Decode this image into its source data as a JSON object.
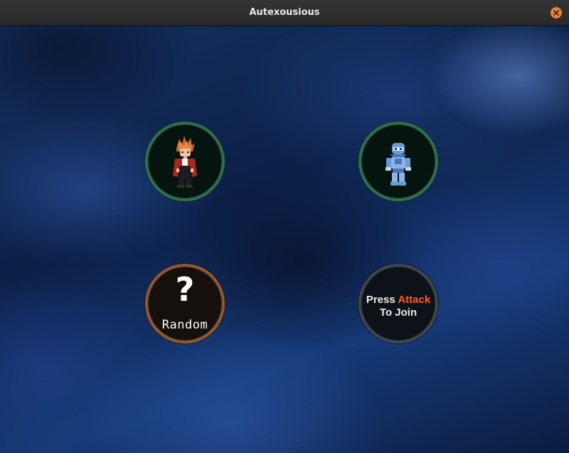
{
  "window": {
    "title": "Autexousious",
    "close_icon": "close-icon",
    "close_color": "#e9813a"
  },
  "slots": [
    {
      "state": "character-selected",
      "character_icon": "red-haired-fighter-sprite",
      "ring_color": "#2f6e52"
    },
    {
      "state": "character-selected",
      "character_icon": "blue-armored-robot-sprite",
      "ring_color": "#2f6e52"
    },
    {
      "state": "random",
      "symbol": "?",
      "label": "Random",
      "ring_color": "#8a5a3a"
    },
    {
      "state": "waiting",
      "line1_prefix": "Press ",
      "line1_accent": "Attack",
      "line2": "To Join",
      "accent_color": "#ff5a1e",
      "ring_color": "#3e4650"
    }
  ]
}
